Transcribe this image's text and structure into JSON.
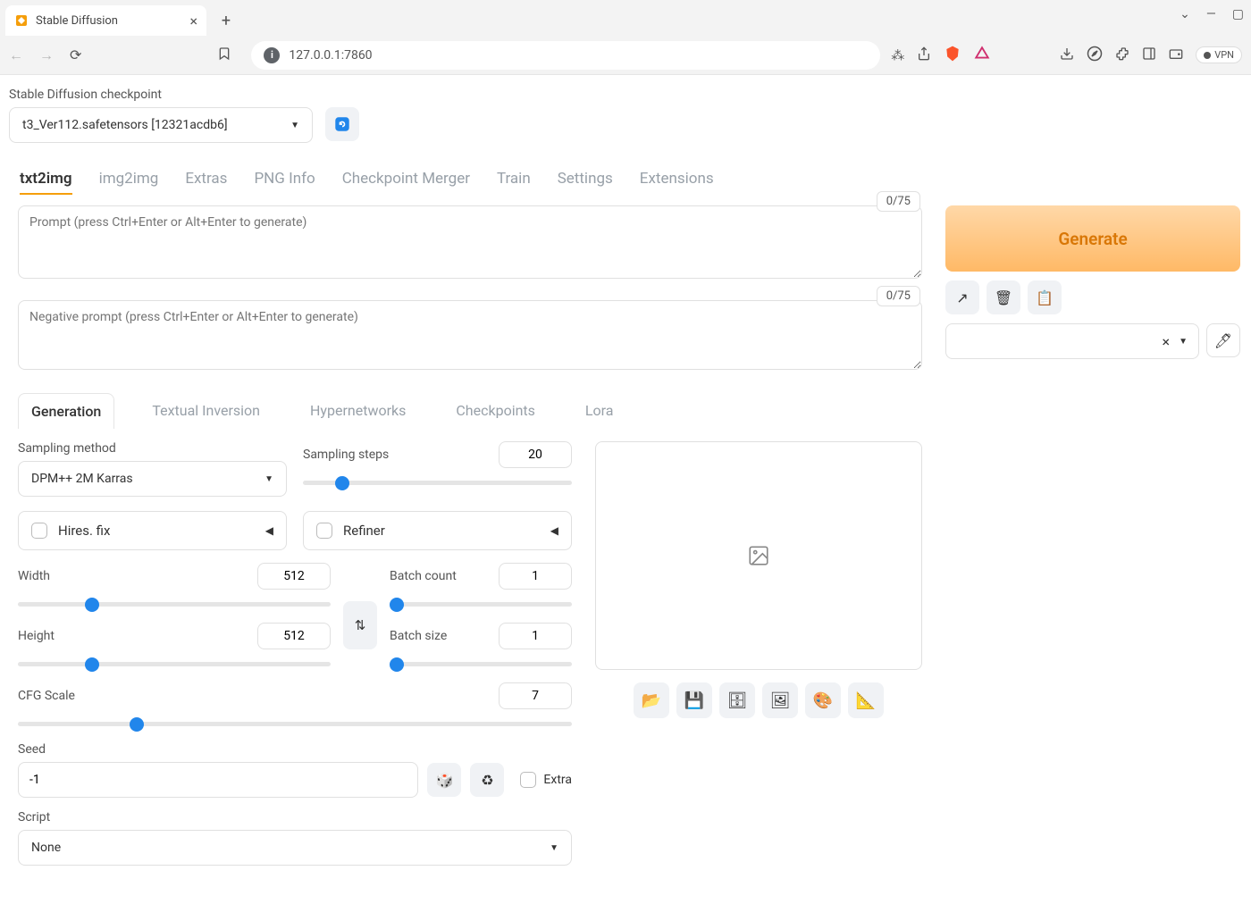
{
  "browser": {
    "tab_title": "Stable Diffusion",
    "url": "127.0.0.1:7860",
    "vpn_label": "VPN"
  },
  "checkpoint": {
    "label": "Stable Diffusion checkpoint",
    "value": "t3_Ver112.safetensors [12321acdb6]"
  },
  "main_tabs": [
    "txt2img",
    "img2img",
    "Extras",
    "PNG Info",
    "Checkpoint Merger",
    "Train",
    "Settings",
    "Extensions"
  ],
  "prompt": {
    "placeholder": "Prompt (press Ctrl+Enter or Alt+Enter to generate)",
    "neg_placeholder": "Negative prompt (press Ctrl+Enter or Alt+Enter to generate)",
    "counter": "0/75",
    "neg_counter": "0/75"
  },
  "generate_label": "Generate",
  "sub_tabs": [
    "Generation",
    "Textual Inversion",
    "Hypernetworks",
    "Checkpoints",
    "Lora"
  ],
  "params": {
    "sampling_method_label": "Sampling method",
    "sampling_method_value": "DPM++ 2M Karras",
    "sampling_steps_label": "Sampling steps",
    "sampling_steps_value": "20",
    "hires_label": "Hires. fix",
    "refiner_label": "Refiner",
    "width_label": "Width",
    "width_value": "512",
    "height_label": "Height",
    "height_value": "512",
    "batch_count_label": "Batch count",
    "batch_count_value": "1",
    "batch_size_label": "Batch size",
    "batch_size_value": "1",
    "cfg_label": "CFG Scale",
    "cfg_value": "7",
    "seed_label": "Seed",
    "seed_value": "-1",
    "extra_label": "Extra",
    "script_label": "Script",
    "script_value": "None"
  }
}
